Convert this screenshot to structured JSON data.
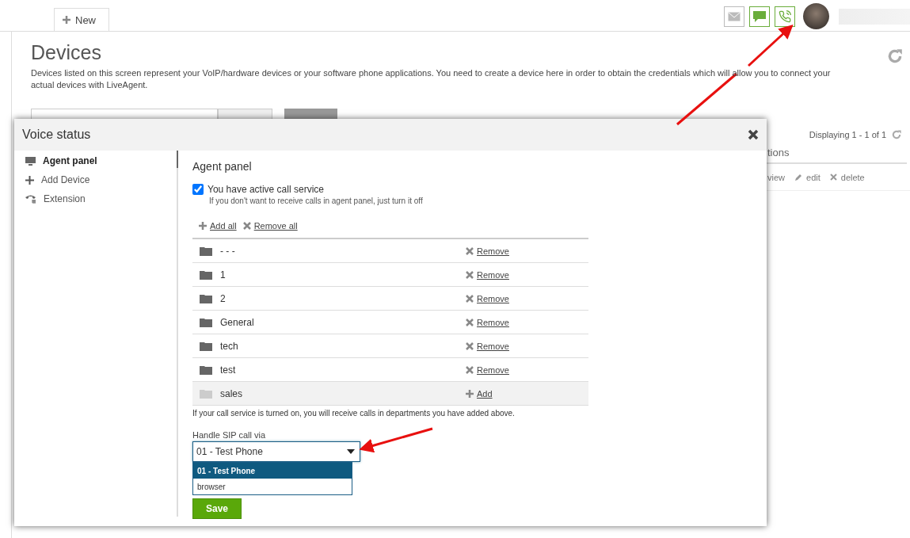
{
  "topbar": {
    "new_tab": "New",
    "icons": [
      {
        "kind": "mail",
        "active": false
      },
      {
        "kind": "chat",
        "active": true
      },
      {
        "kind": "phone",
        "active": true
      }
    ]
  },
  "page": {
    "title": "Devices",
    "description": "Devices listed on this screen represent your VoIP/hardware devices or your software phone applications. You need to create a device here in order to obtain the credentials which will allow you to connect your actual devices with LiveAgent.",
    "paging": "Displaying 1 - 1 of 1",
    "column": "tions",
    "row_actions": [
      {
        "kind": "view",
        "label": "view"
      },
      {
        "kind": "edit",
        "label": "edit"
      },
      {
        "kind": "delete",
        "label": "delete"
      }
    ]
  },
  "dialog": {
    "title": "Voice status",
    "nav": [
      {
        "kind": "monitor",
        "label": "Agent panel",
        "selected": true
      },
      {
        "kind": "plus",
        "label": "Add Device",
        "selected": false
      },
      {
        "kind": "extension",
        "label": "Extension",
        "selected": false
      }
    ],
    "heading": "Agent panel",
    "active_service": {
      "label": "You have active call service",
      "checked": true,
      "hint": "If you don't want to receive calls in agent panel, just turn it off"
    },
    "add_all": "Add all",
    "remove_all": "Remove all",
    "departments": [
      {
        "name": "- - -",
        "added": true,
        "action": "Remove"
      },
      {
        "name": "1",
        "added": true,
        "action": "Remove"
      },
      {
        "name": "2",
        "added": true,
        "action": "Remove"
      },
      {
        "name": "General",
        "added": true,
        "action": "Remove"
      },
      {
        "name": "tech",
        "added": true,
        "action": "Remove"
      },
      {
        "name": "test",
        "added": true,
        "action": "Remove"
      },
      {
        "name": "sales",
        "added": false,
        "action": "Add"
      }
    ],
    "note": "If your call service is turned on, you will receive calls in departments you have added above.",
    "sip": {
      "label": "Handle SIP call via",
      "value": "01 - Test Phone",
      "options": [
        {
          "label": "01 - Test Phone",
          "selected": true
        },
        {
          "label": "browser",
          "selected": false
        }
      ]
    },
    "save": "Save"
  }
}
